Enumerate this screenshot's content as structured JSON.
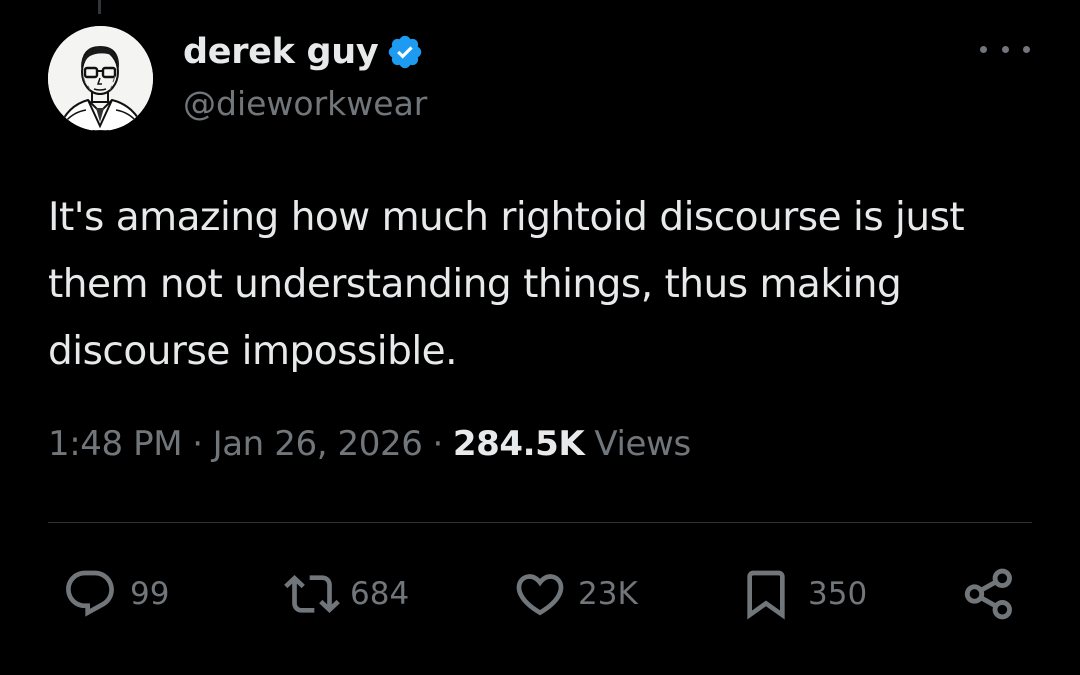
{
  "tweet": {
    "display_name": "derek guy",
    "handle": "@dieworkwear",
    "verified": true,
    "text": "It's amazing how much rightoid discourse is just them not understanding things, thus making discourse impossible.",
    "time": "1:48 PM",
    "separator": "·",
    "date": "Jan 26, 2026",
    "views_count": "284.5K",
    "views_label": "Views"
  },
  "actions": {
    "replies": "99",
    "reposts": "684",
    "likes": "23K",
    "bookmarks": "350"
  },
  "icons": {
    "verified": "verified-badge-icon",
    "more": "more-options-icon",
    "reply": "reply-bubble-icon",
    "repost": "repost-arrows-icon",
    "like": "heart-icon",
    "bookmark": "bookmark-icon",
    "share": "share-icon"
  },
  "colors": {
    "background": "#000000",
    "primary_text": "#e7e9ea",
    "secondary_text": "#71767b",
    "verified_blue": "#1d9bf0",
    "divider": "#2f3336"
  }
}
